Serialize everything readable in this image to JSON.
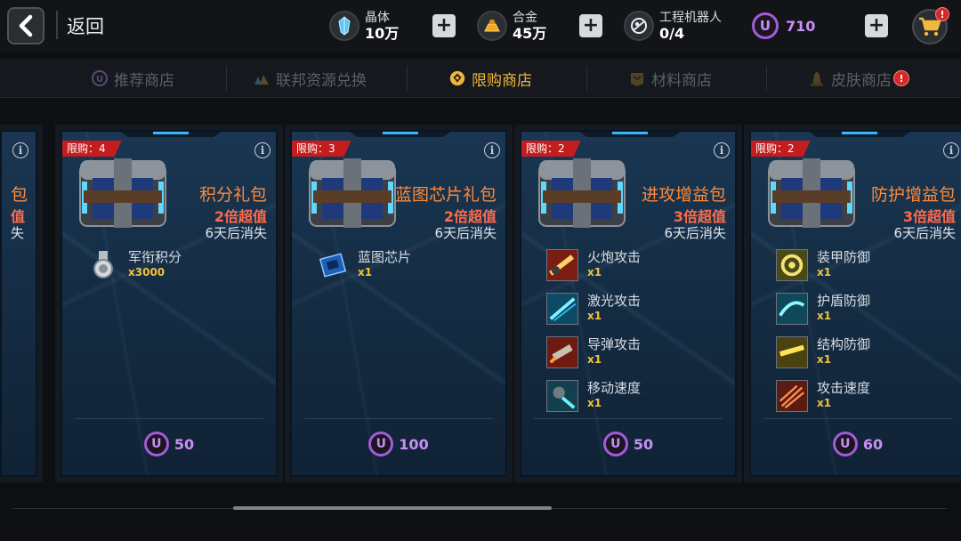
{
  "header": {
    "back_label": "返回",
    "resources": [
      {
        "name": "晶体",
        "value": "10万",
        "icon": "crystal-icon"
      },
      {
        "name": "合金",
        "value": "45万",
        "icon": "alloy-icon"
      },
      {
        "name": "工程机器人",
        "value": "0/4",
        "icon": "robot-icon"
      }
    ],
    "currency": {
      "symbol": "U",
      "value": "710"
    },
    "cart_badge": "!"
  },
  "tabs": [
    {
      "label": "推荐商店",
      "icon": "u-coin-icon",
      "active": false
    },
    {
      "label": "联邦资源兑换",
      "icon": "resources-icon",
      "active": false
    },
    {
      "label": "限购商店",
      "icon": "limited-shop-icon",
      "active": true
    },
    {
      "label": "材料商店",
      "icon": "materials-icon",
      "active": false
    },
    {
      "label": "皮肤商店",
      "icon": "skin-icon",
      "active": false,
      "badge": "!"
    }
  ],
  "partial_card": {
    "name": "包",
    "value": "值",
    "expire": "失"
  },
  "cards": [
    {
      "limit": "限购：4",
      "name": "积分礼包",
      "value": "2倍超值",
      "expire": "6天后消失",
      "items": [
        {
          "name": "军衔积分",
          "qty": "x3000",
          "icon": "rank-medal-icon"
        }
      ],
      "price": "50"
    },
    {
      "limit": "限购：3",
      "name": "蓝图芯片礼包",
      "value": "2倍超值",
      "expire": "6天后消失",
      "items": [
        {
          "name": "蓝图芯片",
          "qty": "x1",
          "icon": "blueprint-chip-icon"
        }
      ],
      "price": "100"
    },
    {
      "limit": "限购：2",
      "name": "进攻增益包",
      "value": "3倍超值",
      "expire": "6天后消失",
      "items": [
        {
          "name": "火炮攻击",
          "qty": "x1",
          "icon": "cannon-attack-icon"
        },
        {
          "name": "激光攻击",
          "qty": "x1",
          "icon": "laser-attack-icon"
        },
        {
          "name": "导弹攻击",
          "qty": "x1",
          "icon": "missile-attack-icon"
        },
        {
          "name": "移动速度",
          "qty": "x1",
          "icon": "move-speed-icon"
        }
      ],
      "price": "50"
    },
    {
      "limit": "限购：2",
      "name": "防护增益包",
      "value": "3倍超值",
      "expire": "6天后消失",
      "items": [
        {
          "name": "装甲防御",
          "qty": "x1",
          "icon": "armor-defense-icon"
        },
        {
          "name": "护盾防御",
          "qty": "x1",
          "icon": "shield-defense-icon"
        },
        {
          "name": "结构防御",
          "qty": "x1",
          "icon": "structure-defense-icon"
        },
        {
          "name": "攻击速度",
          "qty": "x1",
          "icon": "attack-speed-icon"
        }
      ],
      "price": "60"
    }
  ],
  "colors": {
    "accent": "#f0b53c",
    "currency": "#c98ef5",
    "pack_name": "#ff8a3a",
    "limit_tag": "#c41d1d"
  }
}
